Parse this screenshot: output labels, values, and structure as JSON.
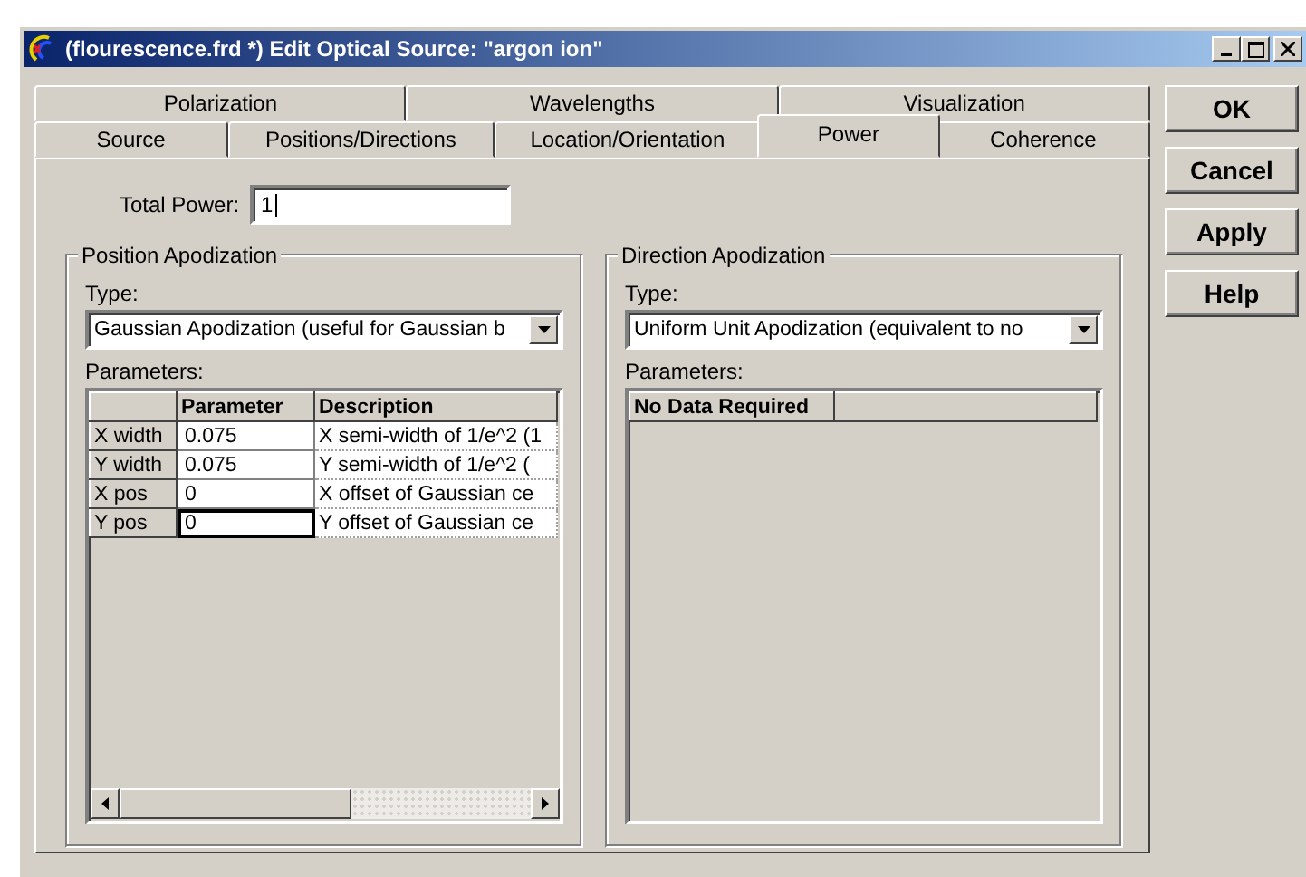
{
  "window": {
    "title": "(flourescence.frd *) Edit Optical Source: \"argon ion\""
  },
  "tab_rows": [
    [
      {
        "label": "Polarization",
        "selected": false
      },
      {
        "label": "Wavelengths",
        "selected": false
      },
      {
        "label": "Visualization",
        "selected": false
      }
    ],
    [
      {
        "label": "Source",
        "selected": false
      },
      {
        "label": "Positions/Directions",
        "selected": false
      },
      {
        "label": "Location/Orientation",
        "selected": false
      },
      {
        "label": "Power",
        "selected": true
      },
      {
        "label": "Coherence",
        "selected": false
      }
    ]
  ],
  "total_power": {
    "label": "Total Power:",
    "value": "1"
  },
  "groups": [
    {
      "title": "Position Apodization",
      "type_label": "Type:",
      "type_value": "Gaussian Apodization (useful for Gaussian b",
      "parameters_label": "Parameters:",
      "columns": [
        "Parameter",
        "Description"
      ],
      "rows": [
        {
          "name": "X width",
          "value": "0.075",
          "description": "X semi-width of 1/e^2 (1",
          "selected": false
        },
        {
          "name": "Y width",
          "value": "0.075",
          "description": "Y semi-width of 1/e^2 (",
          "selected": false
        },
        {
          "name": "X pos",
          "value": "0",
          "description": "X offset of Gaussian ce",
          "selected": false
        },
        {
          "name": "Y pos",
          "value": "0",
          "description": "Y offset of Gaussian ce",
          "selected": true
        }
      ]
    },
    {
      "title": "Direction Apodization",
      "type_label": "Type:",
      "type_value": "Uniform Unit Apodization (equivalent to no",
      "parameters_label": "Parameters:",
      "columns": [
        "No Data Required"
      ]
    }
  ],
  "buttons": [
    "OK",
    "Cancel",
    "Apply",
    "Help"
  ]
}
